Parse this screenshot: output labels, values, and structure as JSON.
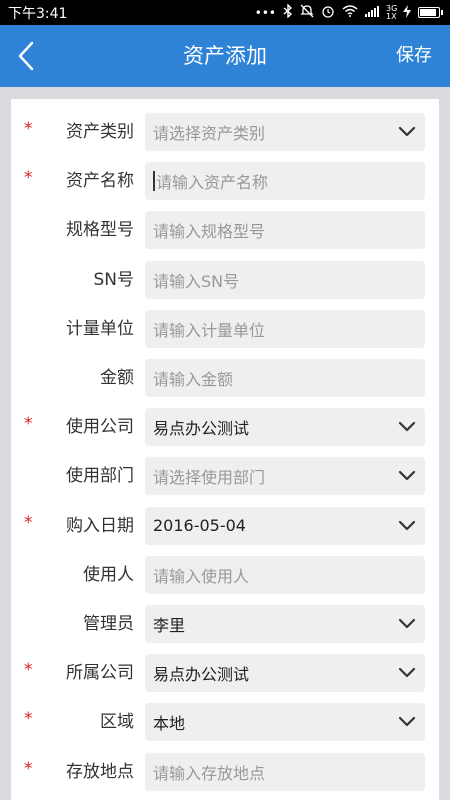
{
  "status_bar": {
    "time": "下午3:41",
    "network": "3G 1X"
  },
  "header": {
    "title": "资产添加",
    "save_label": "保存"
  },
  "form": {
    "fields": [
      {
        "label": "资产类别",
        "required": true,
        "type": "select",
        "value": "",
        "placeholder": "请选择资产类别"
      },
      {
        "label": "资产名称",
        "required": true,
        "type": "input",
        "value": "",
        "placeholder": "请输入资产名称",
        "focused": true
      },
      {
        "label": "规格型号",
        "required": false,
        "type": "input",
        "value": "",
        "placeholder": "请输入规格型号"
      },
      {
        "label": "SN号",
        "required": false,
        "type": "input",
        "value": "",
        "placeholder": "请输入SN号"
      },
      {
        "label": "计量单位",
        "required": false,
        "type": "input",
        "value": "",
        "placeholder": "请输入计量单位"
      },
      {
        "label": "金额",
        "required": false,
        "type": "input",
        "value": "",
        "placeholder": "请输入金额"
      },
      {
        "label": "使用公司",
        "required": true,
        "type": "select",
        "value": "易点办公测试",
        "placeholder": ""
      },
      {
        "label": "使用部门",
        "required": false,
        "type": "select",
        "value": "",
        "placeholder": "请选择使用部门"
      },
      {
        "label": "购入日期",
        "required": true,
        "type": "select",
        "value": "2016-05-04",
        "placeholder": ""
      },
      {
        "label": "使用人",
        "required": false,
        "type": "input",
        "value": "",
        "placeholder": "请输入使用人"
      },
      {
        "label": "管理员",
        "required": false,
        "type": "select",
        "value": "李里",
        "placeholder": ""
      },
      {
        "label": "所属公司",
        "required": true,
        "type": "select",
        "value": "易点办公测试",
        "placeholder": ""
      },
      {
        "label": "区域",
        "required": true,
        "type": "select",
        "value": "本地",
        "placeholder": ""
      },
      {
        "label": "存放地点",
        "required": true,
        "type": "input",
        "value": "",
        "placeholder": "请输入存放地点"
      }
    ]
  },
  "colors": {
    "app_bar": "#2e83d7",
    "required_star": "#e02020",
    "field_bg": "#efefef"
  }
}
